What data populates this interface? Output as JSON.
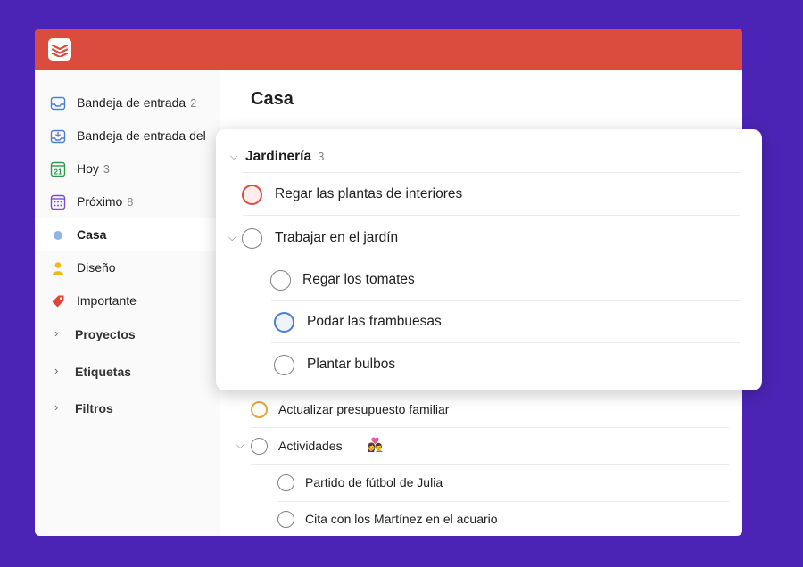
{
  "sidebar": {
    "items": [
      {
        "label": "Bandeja de entrada",
        "count": "2",
        "icon": "inbox-icon"
      },
      {
        "label": "Bandeja de entrada del",
        "count": "",
        "icon": "team-inbox-icon"
      },
      {
        "label": "Hoy",
        "count": "3",
        "icon": "calendar-today-icon",
        "day": "21"
      },
      {
        "label": "Próximo",
        "count": "8",
        "icon": "calendar-upcoming-icon"
      },
      {
        "label": "Casa",
        "count": "",
        "icon": "dot-icon"
      },
      {
        "label": "Diseño",
        "count": "",
        "icon": "person-icon"
      },
      {
        "label": "Importante",
        "count": "",
        "icon": "tag-icon"
      }
    ],
    "sections": [
      {
        "label": "Proyectos"
      },
      {
        "label": "Etiquetas"
      },
      {
        "label": "Filtros"
      }
    ]
  },
  "main": {
    "title": "Casa",
    "tasks": [
      {
        "text": "Actualizar presupuesto familiar",
        "priority_color": "#e8a33a"
      },
      {
        "text": "Actividades",
        "emoji": "👩‍❤️‍👨"
      },
      {
        "text": "Partido de fútbol de Julia"
      },
      {
        "text": "Cita con los Martínez en el acuario"
      }
    ]
  },
  "popup": {
    "section": {
      "title": "Jardinería",
      "count": "3"
    },
    "tasks": [
      {
        "text": "Regar las plantas de interiores",
        "priority_color": "#db4c3f"
      },
      {
        "text": "Trabajar en el jardín"
      },
      {
        "text": "Regar los tomates"
      },
      {
        "text": "Podar las frambuesas",
        "priority_color": "#4a7fd4"
      },
      {
        "text": "Plantar bulbos"
      }
    ]
  },
  "colors": {
    "brand": "#db4c3f",
    "background": "#4b24b5"
  }
}
